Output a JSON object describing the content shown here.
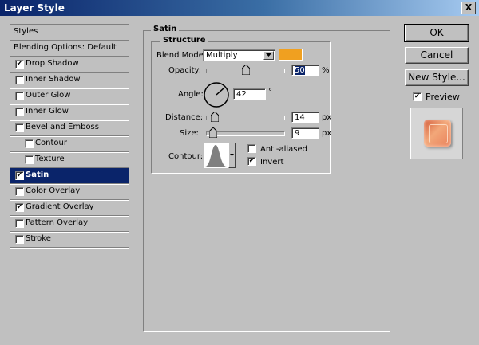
{
  "window": {
    "title": "Layer Style",
    "close_glyph": "X"
  },
  "styles_list": [
    {
      "label": "Styles",
      "checkbox": false,
      "checked": false,
      "indent": false,
      "selected": false
    },
    {
      "label": "Blending Options: Default",
      "checkbox": false,
      "checked": false,
      "indent": false,
      "selected": false
    },
    {
      "label": "Drop Shadow",
      "checkbox": true,
      "checked": true,
      "indent": false,
      "selected": false
    },
    {
      "label": "Inner Shadow",
      "checkbox": true,
      "checked": false,
      "indent": false,
      "selected": false
    },
    {
      "label": "Outer Glow",
      "checkbox": true,
      "checked": false,
      "indent": false,
      "selected": false
    },
    {
      "label": "Inner Glow",
      "checkbox": true,
      "checked": false,
      "indent": false,
      "selected": false
    },
    {
      "label": "Bevel and Emboss",
      "checkbox": true,
      "checked": false,
      "indent": false,
      "selected": false
    },
    {
      "label": "Contour",
      "checkbox": true,
      "checked": false,
      "indent": true,
      "selected": false
    },
    {
      "label": "Texture",
      "checkbox": true,
      "checked": false,
      "indent": true,
      "selected": false
    },
    {
      "label": "Satin",
      "checkbox": true,
      "checked": true,
      "indent": false,
      "selected": true
    },
    {
      "label": "Color Overlay",
      "checkbox": true,
      "checked": false,
      "indent": false,
      "selected": false
    },
    {
      "label": "Gradient Overlay",
      "checkbox": true,
      "checked": true,
      "indent": false,
      "selected": false
    },
    {
      "label": "Pattern Overlay",
      "checkbox": true,
      "checked": false,
      "indent": false,
      "selected": false
    },
    {
      "label": "Stroke",
      "checkbox": true,
      "checked": false,
      "indent": false,
      "selected": false
    }
  ],
  "satin": {
    "group_title": "Satin",
    "structure_title": "Structure",
    "blend_mode_label": "Blend Mode:",
    "blend_mode_value": "Multiply",
    "color": "#f0a020",
    "opacity_label": "Opacity:",
    "opacity_value": "50",
    "opacity_unit": "%",
    "opacity_fraction": 0.5,
    "angle_label": "Angle:",
    "angle_value": "42",
    "angle_unit": "°",
    "angle_degrees": 42,
    "distance_label": "Distance:",
    "distance_value": "14",
    "distance_unit": "px",
    "distance_fraction": 0.06,
    "size_label": "Size:",
    "size_value": "9",
    "size_unit": "px",
    "size_fraction": 0.04,
    "contour_label": "Contour:",
    "anti_aliased_label": "Anti-aliased",
    "anti_aliased_checked": false,
    "invert_label": "Invert",
    "invert_checked": true
  },
  "buttons": {
    "ok": "OK",
    "cancel": "Cancel",
    "new_style": "New Style..."
  },
  "preview": {
    "label": "Preview",
    "checked": true
  }
}
